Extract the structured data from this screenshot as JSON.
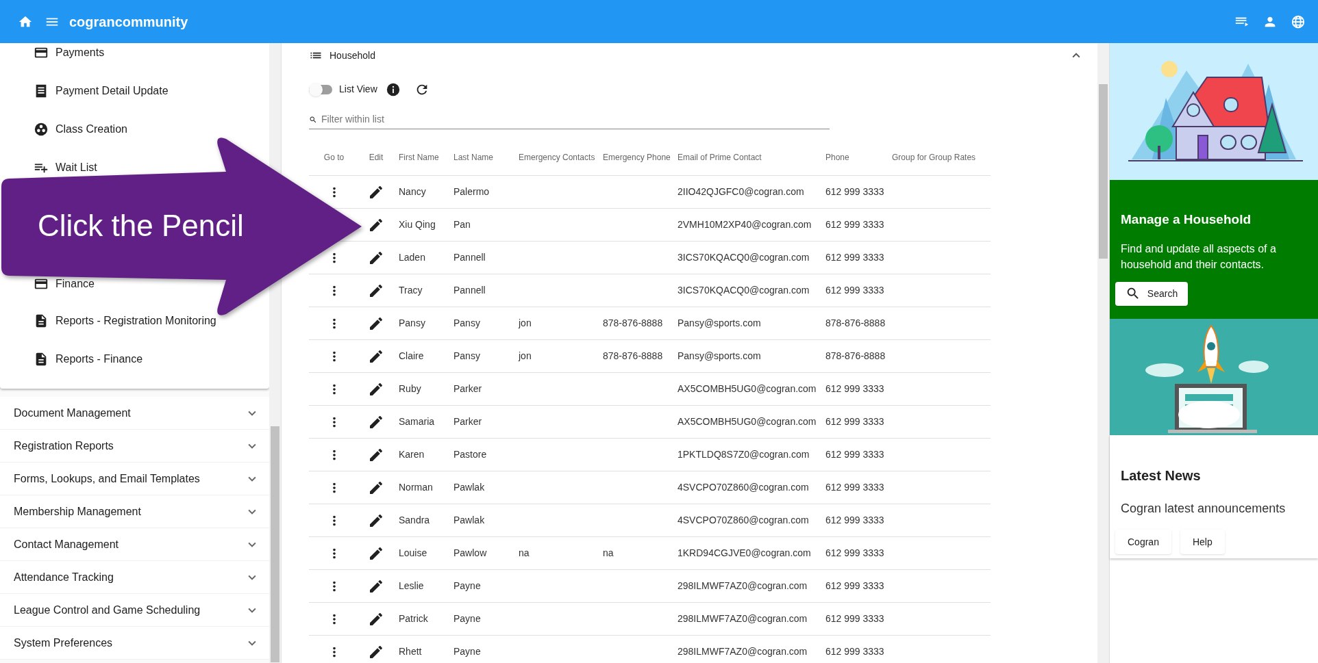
{
  "app_bar": {
    "title": "cograncommunity"
  },
  "sidebar": {
    "items": [
      {
        "label": "Payments"
      },
      {
        "label": "Payment Detail Update"
      },
      {
        "label": "Class Creation"
      },
      {
        "label": "Wait List"
      },
      {
        "label": "Finance"
      },
      {
        "label": "Reports - Registration Monitoring"
      },
      {
        "label": "Reports - Finance"
      }
    ],
    "sections": [
      {
        "label": "Document Management",
        "expanded": false
      },
      {
        "label": "Registration Reports",
        "expanded": false
      },
      {
        "label": "Forms, Lookups, and Email Templates",
        "expanded": false
      },
      {
        "label": "Membership Management",
        "expanded": false
      },
      {
        "label": "Contact Management",
        "expanded": false
      },
      {
        "label": "Attendance Tracking",
        "expanded": false
      },
      {
        "label": "League Control and Game Scheduling",
        "expanded": false
      },
      {
        "label": "System Preferences",
        "expanded": false
      }
    ]
  },
  "panel": {
    "title": "Household",
    "expanded": true,
    "list_view": {
      "label": "List View",
      "on": false
    },
    "filter": {
      "placeholder": "Filter within list"
    },
    "table": {
      "columns": [
        "Go to",
        "Edit",
        "First Name",
        "Last Name",
        "Emergency Contacts",
        "Emergency Phone",
        "Email of Prime Contact",
        "Phone",
        "Group for Group Rates"
      ],
      "rows": [
        {
          "first_name": "Nancy",
          "last_name": "Palermo",
          "email": "2IIO42QJGFC0@cogran.com",
          "phone": "612 999 3333"
        },
        {
          "first_name": "Xiu Qing",
          "last_name": "Pan",
          "email": "2VMH10M2XP40@cogran.com",
          "phone": "612 999 3333"
        },
        {
          "first_name": "Laden",
          "last_name": "Pannell",
          "email": "3ICS70KQACQ0@cogran.com",
          "phone": "612 999 3333"
        },
        {
          "first_name": "Tracy",
          "last_name": "Pannell",
          "email": "3ICS70KQACQ0@cogran.com",
          "phone": "612 999 3333"
        },
        {
          "first_name": "Pansy",
          "last_name": "Pansy",
          "emergency_contact": "jon",
          "emergency_phone": "878-876-8888",
          "email": "Pansy@sports.com",
          "phone": "878-876-8888"
        },
        {
          "first_name": "Claire",
          "last_name": "Pansy",
          "emergency_contact": "jon",
          "emergency_phone": "878-876-8888",
          "email": "Pansy@sports.com",
          "phone": "878-876-8888"
        },
        {
          "first_name": "Ruby",
          "last_name": "Parker",
          "email": "AX5COMBH5UG0@cogran.com",
          "phone": "612 999 3333"
        },
        {
          "first_name": "Samaria",
          "last_name": "Parker",
          "email": "AX5COMBH5UG0@cogran.com",
          "phone": "612 999 3333"
        },
        {
          "first_name": "Karen",
          "last_name": "Pastore",
          "email": "1PKTLDQ8S7Z0@cogran.com",
          "phone": "612 999 3333"
        },
        {
          "first_name": "Norman",
          "last_name": "Pawlak",
          "email": "4SVCPO70Z860@cogran.com",
          "phone": "612 999 3333"
        },
        {
          "first_name": "Sandra",
          "last_name": "Pawlak",
          "email": "4SVCPO70Z860@cogran.com",
          "phone": "612 999 3333"
        },
        {
          "first_name": "Louise",
          "last_name": "Pawlow",
          "emergency_contact": "na",
          "emergency_phone": "na",
          "email": "1KRD94CGJVE0@cogran.com",
          "phone": "612 999 3333"
        },
        {
          "first_name": "Leslie",
          "last_name": "Payne",
          "email": "298ILMWF7AZ0@cogran.com",
          "phone": "612 999 3333"
        },
        {
          "first_name": "Patrick",
          "last_name": "Payne",
          "email": "298ILMWF7AZ0@cogran.com",
          "phone": "612 999 3333"
        },
        {
          "first_name": "Rhett",
          "last_name": "Payne",
          "email": "298ILMWF7AZ0@cogran.com",
          "phone": "612 999 3333"
        }
      ]
    }
  },
  "household_card": {
    "title": "Manage a Household",
    "text": "Find and update all aspects of a household and their contacts.",
    "button": "Search"
  },
  "news_card": {
    "title": "Latest News",
    "text": "Cogran latest announcements",
    "buttons": [
      "Cogran",
      "Help"
    ]
  },
  "callout": {
    "text": "Click the Pencil"
  }
}
